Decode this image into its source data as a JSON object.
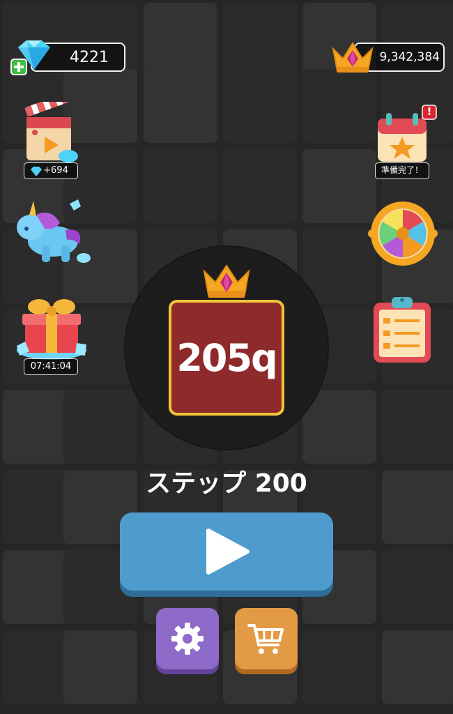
{
  "currency": {
    "gems": "4221",
    "crowns": "9,342,384"
  },
  "left_rewards": {
    "video_reward": "+694",
    "gift_timer": "07:41:04"
  },
  "right_rewards": {
    "calendar_status": "準備完了！",
    "calendar_alert": "!"
  },
  "tile": {
    "value": "205q"
  },
  "step": {
    "label": "ステップ 200"
  },
  "colors": {
    "background": "#262626",
    "tile_fill": "#8e2a2b",
    "tile_border": "#f2c437",
    "play_button": "#4e9ccd",
    "settings_button": "#8e6ac9",
    "shop_button": "#e39a44"
  },
  "icons": {
    "gem": "diamond-icon",
    "crown": "crown-icon",
    "add": "plus-icon",
    "video": "clapperboard-icon",
    "unicorn": "unicorn-icon",
    "gift": "gift-icon",
    "calendar": "calendar-star-icon",
    "wheel": "prize-wheel-icon",
    "tasks": "clipboard-list-icon",
    "play": "play-icon",
    "settings": "gear-icon",
    "shop": "cart-icon"
  }
}
